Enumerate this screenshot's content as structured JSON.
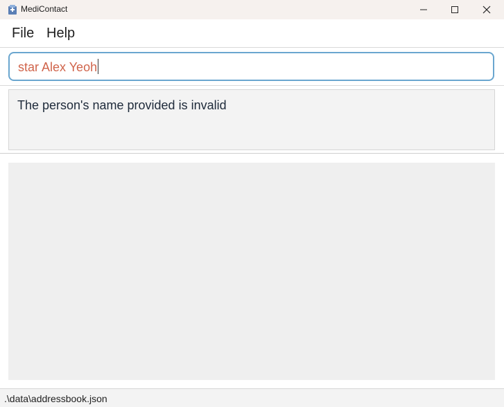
{
  "window": {
    "title": "MediContact",
    "controls": [
      "minimize",
      "maximize",
      "close"
    ]
  },
  "menu": {
    "file_label": "File",
    "help_label": "Help"
  },
  "command": {
    "value": "star Alex Yeoh"
  },
  "result": {
    "message": "The person's name provided is invalid"
  },
  "status": {
    "path": ".\\data\\addressbook.json"
  },
  "colors": {
    "command_text": "#d0644b",
    "command_border": "#6aa6cf",
    "titlebar_bg": "#f6f1ee"
  }
}
